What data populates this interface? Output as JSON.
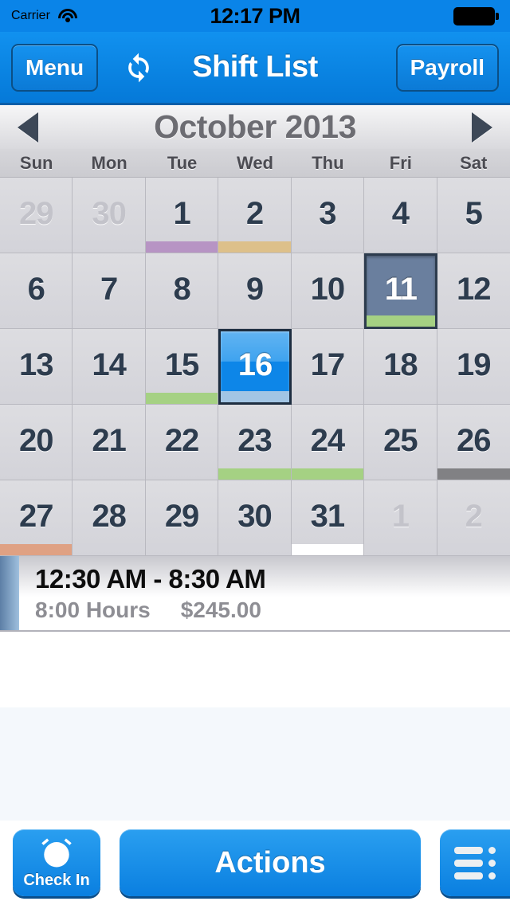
{
  "status_bar": {
    "carrier": "Carrier",
    "wifi_icon": "wifi-icon",
    "time": "12:17 PM",
    "battery_icon": "battery-full-icon"
  },
  "nav_bar": {
    "menu_label": "Menu",
    "refresh_icon": "refresh-sync-icon",
    "title": "Shift List",
    "payroll_label": "Payroll"
  },
  "calendar": {
    "prev_icon": "triangle-left-icon",
    "month_title": "October 2013",
    "next_icon": "triangle-right-icon",
    "weekdays": [
      "Sun",
      "Mon",
      "Tue",
      "Wed",
      "Thu",
      "Fri",
      "Sat"
    ],
    "colors": {
      "purple": "#b794c4",
      "tan": "#ddc08a",
      "green": "#a5d183",
      "gray": "#818184",
      "salmon": "#dfa183",
      "white": "#ffffff",
      "selected_bar": "#a2c5e4",
      "today_bg": "#6a7f9e",
      "selected_bg": "#0d86e8"
    },
    "days": [
      {
        "num": "29",
        "month": "other",
        "state": "normal",
        "bar": null
      },
      {
        "num": "30",
        "month": "other",
        "state": "normal",
        "bar": null
      },
      {
        "num": "1",
        "month": "current",
        "state": "normal",
        "bar": "#b794c4"
      },
      {
        "num": "2",
        "month": "current",
        "state": "normal",
        "bar": "#ddc08a"
      },
      {
        "num": "3",
        "month": "current",
        "state": "normal",
        "bar": null
      },
      {
        "num": "4",
        "month": "current",
        "state": "normal",
        "bar": null
      },
      {
        "num": "5",
        "month": "current",
        "state": "normal",
        "bar": null
      },
      {
        "num": "6",
        "month": "current",
        "state": "normal",
        "bar": null
      },
      {
        "num": "7",
        "month": "current",
        "state": "normal",
        "bar": null
      },
      {
        "num": "8",
        "month": "current",
        "state": "normal",
        "bar": null
      },
      {
        "num": "9",
        "month": "current",
        "state": "normal",
        "bar": null
      },
      {
        "num": "10",
        "month": "current",
        "state": "normal",
        "bar": null
      },
      {
        "num": "11",
        "month": "current",
        "state": "today",
        "bar": "#a5d183"
      },
      {
        "num": "12",
        "month": "current",
        "state": "normal",
        "bar": null
      },
      {
        "num": "13",
        "month": "current",
        "state": "normal",
        "bar": null
      },
      {
        "num": "14",
        "month": "current",
        "state": "normal",
        "bar": null
      },
      {
        "num": "15",
        "month": "current",
        "state": "normal",
        "bar": "#a5d183"
      },
      {
        "num": "16",
        "month": "current",
        "state": "selected",
        "bar": "#a2c5e4"
      },
      {
        "num": "17",
        "month": "current",
        "state": "normal",
        "bar": null
      },
      {
        "num": "18",
        "month": "current",
        "state": "normal",
        "bar": null
      },
      {
        "num": "19",
        "month": "current",
        "state": "normal",
        "bar": null
      },
      {
        "num": "20",
        "month": "current",
        "state": "normal",
        "bar": null
      },
      {
        "num": "21",
        "month": "current",
        "state": "normal",
        "bar": null
      },
      {
        "num": "22",
        "month": "current",
        "state": "normal",
        "bar": null
      },
      {
        "num": "23",
        "month": "current",
        "state": "normal",
        "bar": "#a5d183"
      },
      {
        "num": "24",
        "month": "current",
        "state": "normal",
        "bar": "#a5d183"
      },
      {
        "num": "25",
        "month": "current",
        "state": "normal",
        "bar": null
      },
      {
        "num": "26",
        "month": "current",
        "state": "normal",
        "bar": "#818184"
      },
      {
        "num": "27",
        "month": "current",
        "state": "normal",
        "bar": "#dfa183"
      },
      {
        "num": "28",
        "month": "current",
        "state": "normal",
        "bar": null
      },
      {
        "num": "29",
        "month": "current",
        "state": "normal",
        "bar": null
      },
      {
        "num": "30",
        "month": "current",
        "state": "normal",
        "bar": null
      },
      {
        "num": "31",
        "month": "current",
        "state": "normal",
        "bar": "#ffffff"
      },
      {
        "num": "1",
        "month": "other",
        "state": "normal",
        "bar": null
      },
      {
        "num": "2",
        "month": "other",
        "state": "normal",
        "bar": null
      }
    ]
  },
  "shifts": [
    {
      "time_range": "12:30 AM - 8:30 AM",
      "hours": "8:00 Hours",
      "amount": "$245.00"
    }
  ],
  "toolbar": {
    "check_in_label": "Check In",
    "check_in_icon": "alarm-clock-icon",
    "actions_label": "Actions",
    "list_menu_icon": "list-menu-icon"
  }
}
